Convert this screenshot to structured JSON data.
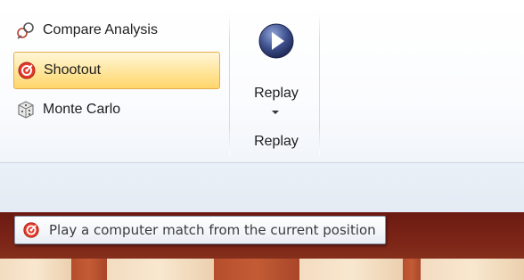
{
  "ribbon": {
    "analysis_group": {
      "items": [
        {
          "label": "Compare Analysis",
          "icon": "compare-icon"
        },
        {
          "label": "Shootout",
          "icon": "shootout-icon",
          "selected": true
        },
        {
          "label": "Monte Carlo",
          "icon": "dice-icon"
        }
      ]
    },
    "replay_group": {
      "button_label": "Replay",
      "group_label": "Replay",
      "icon": "play-icon"
    }
  },
  "tooltip": {
    "text": "Play a computer match from the current position",
    "icon": "shootout-icon"
  },
  "colors": {
    "selected_border": "#e3b04b",
    "selected_fill": "#ffe59a",
    "play_button": "#3d4f8c",
    "board_dark": "#7d2618",
    "board_light": "#f3dcc0"
  }
}
